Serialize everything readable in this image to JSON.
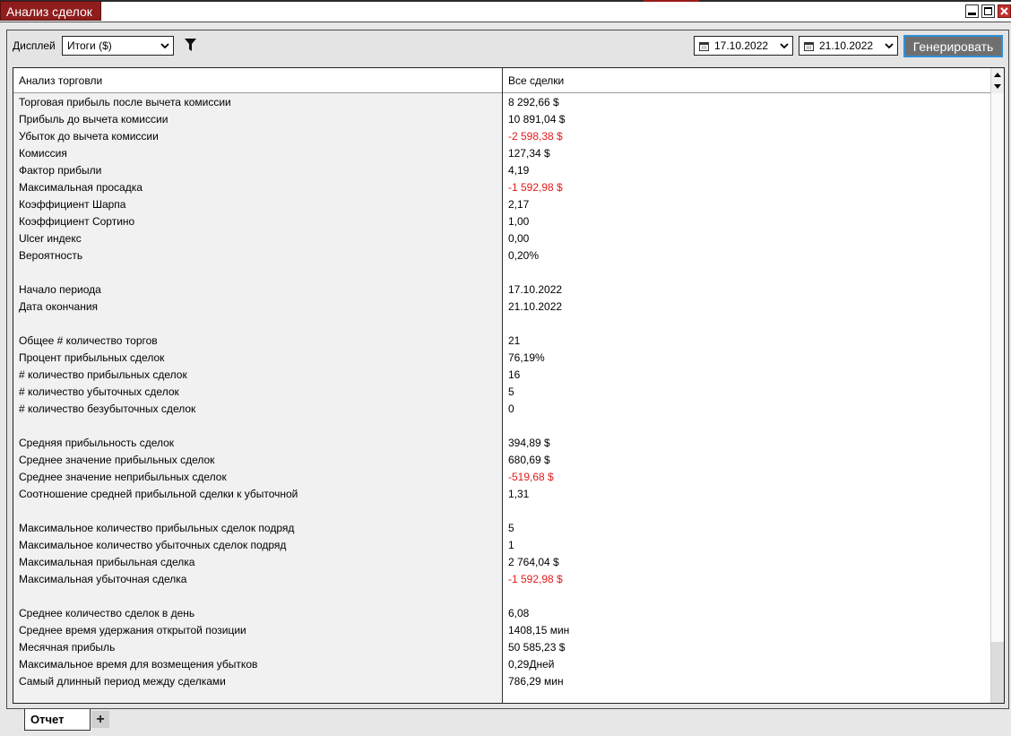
{
  "window": {
    "title": "Анализ сделок"
  },
  "toolbar": {
    "display_label": "Дисплей",
    "display_value": "Итоги ($)",
    "date_from": "17.10.2022",
    "date_to": "21.10.2022",
    "generate_label": "Генерировать"
  },
  "table": {
    "col1_header": "Анализ торговли",
    "col2_header": "Все сделки",
    "rows": [
      {
        "label": "Торговая прибыль после вычета комиссии",
        "value": "8 292,66 $"
      },
      {
        "label": "Прибыль до вычета комиссии",
        "value": "10 891,04 $"
      },
      {
        "label": "Убыток до вычета комиссии",
        "value": "-2 598,38 $",
        "negative": true
      },
      {
        "label": "Комиссия",
        "value": "127,34 $"
      },
      {
        "label": "Фактор прибыли",
        "value": "4,19"
      },
      {
        "label": "Максимальная просадка",
        "value": "-1 592,98 $",
        "negative": true
      },
      {
        "label": "Коэффициент Шарпа",
        "value": "2,17"
      },
      {
        "label": "Коэффициент Сортино",
        "value": "1,00"
      },
      {
        "label": "Ulcer индекс",
        "value": "0,00"
      },
      {
        "label": "Вероятность",
        "value": "0,20%"
      },
      {
        "label": "",
        "value": ""
      },
      {
        "label": "Начало периода",
        "value": "17.10.2022"
      },
      {
        "label": "Дата окончания",
        "value": "21.10.2022"
      },
      {
        "label": "",
        "value": ""
      },
      {
        "label": "Общее # количество торгов",
        "value": "21"
      },
      {
        "label": "Процент прибыльных сделок",
        "value": "76,19%"
      },
      {
        "label": "# количество прибыльных сделок",
        "value": "16"
      },
      {
        "label": "# количество убыточных сделок",
        "value": "5"
      },
      {
        "label": "# количество безубыточных сделок",
        "value": "0"
      },
      {
        "label": "",
        "value": ""
      },
      {
        "label": "Средняя прибыльность сделок",
        "value": "394,89 $"
      },
      {
        "label": "Среднее значение прибыльных сделок",
        "value": "680,69 $"
      },
      {
        "label": "Среднее значение неприбыльных сделок",
        "value": "-519,68 $",
        "negative": true
      },
      {
        "label": "Соотношение средней прибыльной сделки к убыточной",
        "value": "1,31"
      },
      {
        "label": "",
        "value": ""
      },
      {
        "label": "Максимальное количество прибыльных сделок подряд",
        "value": "5"
      },
      {
        "label": "Максимальное количество убыточных сделок подряд",
        "value": "1"
      },
      {
        "label": "Максимальная прибыльная сделка",
        "value": "2 764,04 $"
      },
      {
        "label": "Максимальная убыточная сделка",
        "value": "-1 592,98 $",
        "negative": true
      },
      {
        "label": "",
        "value": ""
      },
      {
        "label": "Среднее количество сделок в день",
        "value": "6,08"
      },
      {
        "label": "Среднее время удержания открытой позиции",
        "value": "1408,15 мин"
      },
      {
        "label": "Месячная прибыль",
        "value": "50 585,23 $"
      },
      {
        "label": "Максимальное время для возмещения убытков",
        "value": "0,29Дней"
      },
      {
        "label": "Самый длинный период между сделками",
        "value": "786,29 мин"
      }
    ]
  },
  "tabs": {
    "report_label": "Отчет",
    "add_label": "+"
  },
  "colors": {
    "title_bg": "#8f1d1d",
    "negative": "#e21b1b",
    "generate_bg": "#6f6f6f",
    "generate_border": "#2f8fd8"
  }
}
